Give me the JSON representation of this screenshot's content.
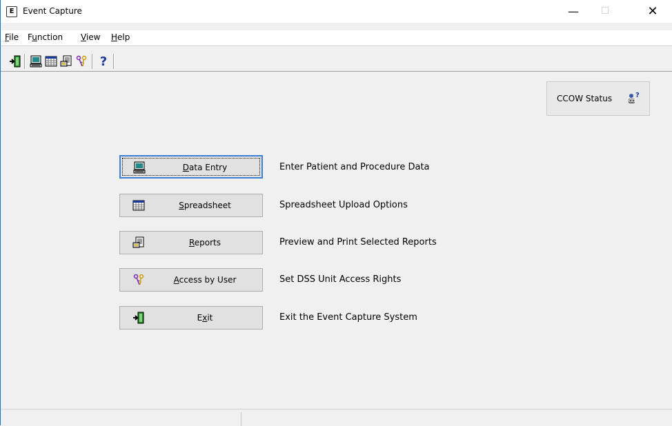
{
  "window": {
    "title": "Event Capture",
    "icon_glyph": "E",
    "controls": {
      "minimize": "—",
      "maximize": "☐",
      "close": "✕"
    }
  },
  "menu": {
    "items": [
      {
        "label": "File",
        "accel": "F",
        "rest": "ile"
      },
      {
        "label": "Function",
        "accel": "u",
        "pre": "F",
        "rest": "nction"
      },
      {
        "label": "View",
        "accel": "V",
        "rest": "iew"
      },
      {
        "label": "Help",
        "accel": "H",
        "rest": "elp"
      }
    ]
  },
  "toolbar": {
    "help_glyph": "?",
    "icons": [
      "exit-icon",
      "data-entry-icon",
      "spreadsheet-icon",
      "reports-icon",
      "access-keys-icon",
      "help-icon"
    ]
  },
  "ccow": {
    "label": "CCOW Status",
    "icon": "ccow-status-icon"
  },
  "actions": [
    {
      "id": "data-entry",
      "pre": "",
      "accel": "D",
      "rest": "ata Entry",
      "description": "Enter Patient and Procedure Data",
      "icon": "data-entry-icon",
      "focused": true
    },
    {
      "id": "spreadsheet",
      "pre": "",
      "accel": "S",
      "rest": "preadsheet",
      "description": "Spreadsheet Upload Options",
      "icon": "spreadsheet-icon",
      "focused": false
    },
    {
      "id": "reports",
      "pre": "",
      "accel": "R",
      "rest": "eports",
      "description": "Preview and Print Selected Reports",
      "icon": "reports-icon",
      "focused": false
    },
    {
      "id": "access-by-user",
      "pre": "",
      "accel": "A",
      "rest": "ccess by User",
      "description": "Set DSS Unit Access Rights",
      "icon": "access-keys-icon",
      "focused": false
    },
    {
      "id": "exit",
      "pre": "E",
      "accel": "x",
      "rest": "it",
      "description": "Exit the Event Capture System",
      "icon": "exit-icon",
      "focused": false
    }
  ],
  "colors": {
    "accent": "#3c7fd6",
    "window_bg": "#f0f0f0",
    "titlebar_bg": "#ffffff"
  }
}
